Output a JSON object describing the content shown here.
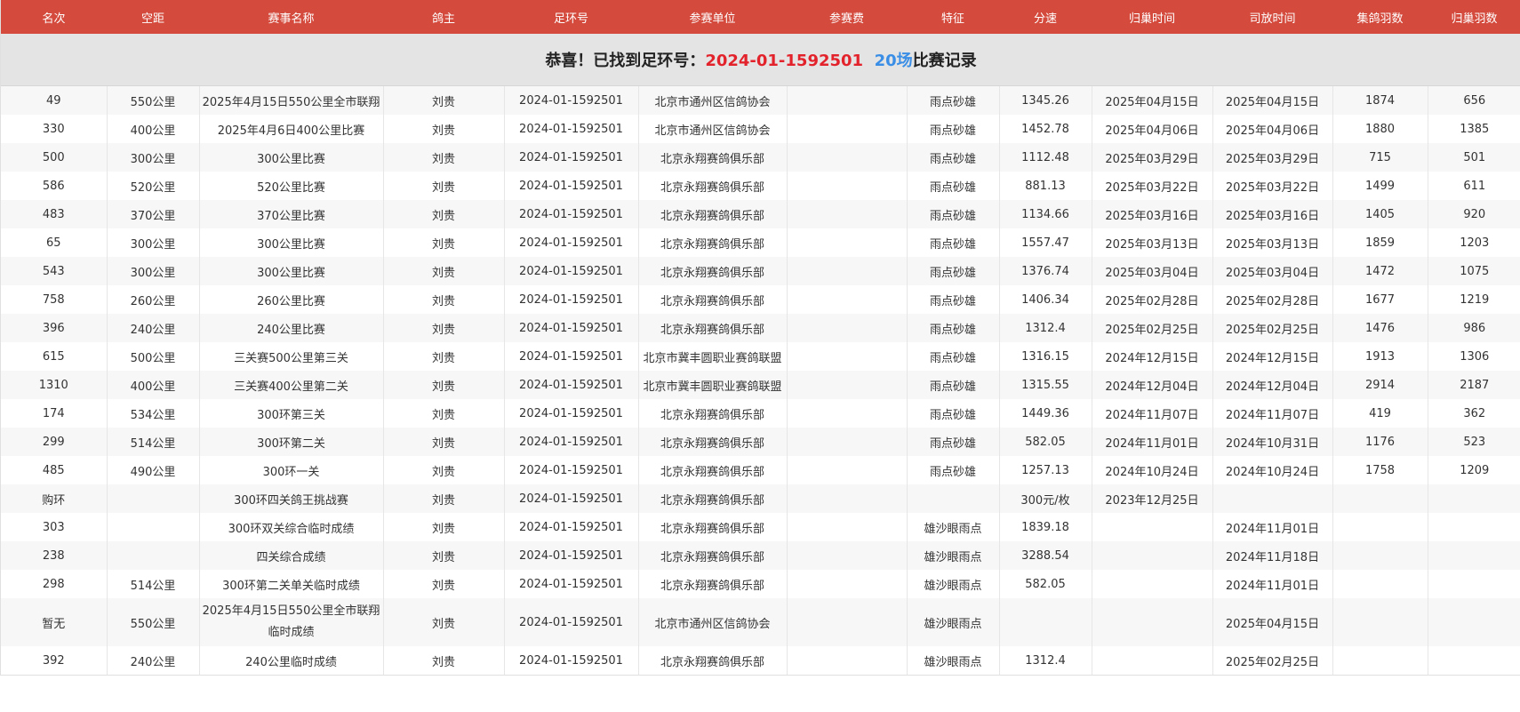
{
  "headers": [
    "名次",
    "空距",
    "赛事名称",
    "鸽主",
    "足环号",
    "参赛单位",
    "参赛费",
    "特征",
    "分速",
    "归巢时间",
    "司放时间",
    "集鸽羽数",
    "归巢羽数"
  ],
  "banner": {
    "prefix": "恭喜！已找到足环号：",
    "ring": "2024-01-1592501",
    "count": "20场",
    "suffix": "比赛记录"
  },
  "rows": [
    [
      "49",
      "550公里",
      "2025年4月15日550公里全市联翔",
      "刘贵",
      "2024-01-1592501",
      "北京市通州区信鸽协会",
      "",
      "雨点砂雄",
      "1345.26",
      "2025年04月15日",
      "2025年04月15日",
      "1874",
      "656"
    ],
    [
      "330",
      "400公里",
      "2025年4月6日400公里比赛",
      "刘贵",
      "2024-01-1592501",
      "北京市通州区信鸽协会",
      "",
      "雨点砂雄",
      "1452.78",
      "2025年04月06日",
      "2025年04月06日",
      "1880",
      "1385"
    ],
    [
      "500",
      "300公里",
      "300公里比赛",
      "刘贵",
      "2024-01-1592501",
      "北京永翔赛鸽俱乐部",
      "",
      "雨点砂雄",
      "1112.48",
      "2025年03月29日",
      "2025年03月29日",
      "715",
      "501"
    ],
    [
      "586",
      "520公里",
      "520公里比赛",
      "刘贵",
      "2024-01-1592501",
      "北京永翔赛鸽俱乐部",
      "",
      "雨点砂雄",
      "881.13",
      "2025年03月22日",
      "2025年03月22日",
      "1499",
      "611"
    ],
    [
      "483",
      "370公里",
      "370公里比赛",
      "刘贵",
      "2024-01-1592501",
      "北京永翔赛鸽俱乐部",
      "",
      "雨点砂雄",
      "1134.66",
      "2025年03月16日",
      "2025年03月16日",
      "1405",
      "920"
    ],
    [
      "65",
      "300公里",
      "300公里比赛",
      "刘贵",
      "2024-01-1592501",
      "北京永翔赛鸽俱乐部",
      "",
      "雨点砂雄",
      "1557.47",
      "2025年03月13日",
      "2025年03月13日",
      "1859",
      "1203"
    ],
    [
      "543",
      "300公里",
      "300公里比赛",
      "刘贵",
      "2024-01-1592501",
      "北京永翔赛鸽俱乐部",
      "",
      "雨点砂雄",
      "1376.74",
      "2025年03月04日",
      "2025年03月04日",
      "1472",
      "1075"
    ],
    [
      "758",
      "260公里",
      "260公里比赛",
      "刘贵",
      "2024-01-1592501",
      "北京永翔赛鸽俱乐部",
      "",
      "雨点砂雄",
      "1406.34",
      "2025年02月28日",
      "2025年02月28日",
      "1677",
      "1219"
    ],
    [
      "396",
      "240公里",
      "240公里比赛",
      "刘贵",
      "2024-01-1592501",
      "北京永翔赛鸽俱乐部",
      "",
      "雨点砂雄",
      "1312.4",
      "2025年02月25日",
      "2025年02月25日",
      "1476",
      "986"
    ],
    [
      "615",
      "500公里",
      "三关赛500公里第三关",
      "刘贵",
      "2024-01-1592501",
      "北京市冀丰圆职业赛鸽联盟",
      "",
      "雨点砂雄",
      "1316.15",
      "2024年12月15日",
      "2024年12月15日",
      "1913",
      "1306"
    ],
    [
      "1310",
      "400公里",
      "三关赛400公里第二关",
      "刘贵",
      "2024-01-1592501",
      "北京市冀丰圆职业赛鸽联盟",
      "",
      "雨点砂雄",
      "1315.55",
      "2024年12月04日",
      "2024年12月04日",
      "2914",
      "2187"
    ],
    [
      "174",
      "534公里",
      "300环第三关",
      "刘贵",
      "2024-01-1592501",
      "北京永翔赛鸽俱乐部",
      "",
      "雨点砂雄",
      "1449.36",
      "2024年11月07日",
      "2024年11月07日",
      "419",
      "362"
    ],
    [
      "299",
      "514公里",
      "300环第二关",
      "刘贵",
      "2024-01-1592501",
      "北京永翔赛鸽俱乐部",
      "",
      "雨点砂雄",
      "582.05",
      "2024年11月01日",
      "2024年10月31日",
      "1176",
      "523"
    ],
    [
      "485",
      "490公里",
      "300环一关",
      "刘贵",
      "2024-01-1592501",
      "北京永翔赛鸽俱乐部",
      "",
      "雨点砂雄",
      "1257.13",
      "2024年10月24日",
      "2024年10月24日",
      "1758",
      "1209"
    ],
    [
      "购环",
      "",
      "300环四关鸽王挑战赛",
      "刘贵",
      "2024-01-1592501",
      "北京永翔赛鸽俱乐部",
      "",
      "",
      "300元/枚",
      "2023年12月25日",
      "",
      "",
      ""
    ],
    [
      "303",
      "",
      "300环双关综合临时成绩",
      "刘贵",
      "2024-01-1592501",
      "北京永翔赛鸽俱乐部",
      "",
      "雄沙眼雨点",
      "1839.18",
      "",
      "2024年11月01日",
      "",
      ""
    ],
    [
      "238",
      "",
      "四关综合成绩",
      "刘贵",
      "2024-01-1592501",
      "北京永翔赛鸽俱乐部",
      "",
      "雄沙眼雨点",
      "3288.54",
      "",
      "2024年11月18日",
      "",
      ""
    ],
    [
      "298",
      "514公里",
      "300环第二关单关临时成绩",
      "刘贵",
      "2024-01-1592501",
      "北京永翔赛鸽俱乐部",
      "",
      "雄沙眼雨点",
      "582.05",
      "",
      "2024年11月01日",
      "",
      ""
    ],
    [
      "暂无",
      "550公里",
      "2025年4月15日550公里全市联翔临时成绩",
      "刘贵",
      "2024-01-1592501",
      "北京市通州区信鸽协会",
      "",
      "雄沙眼雨点",
      "",
      "",
      "2025年04月15日",
      "",
      ""
    ],
    [
      "392",
      "240公里",
      "240公里临时成绩",
      "刘贵",
      "2024-01-1592501",
      "北京永翔赛鸽俱乐部",
      "",
      "雄沙眼雨点",
      "1312.4",
      "",
      "2025年02月25日",
      "",
      ""
    ]
  ],
  "colors": {
    "header_bg": "#d44a3c",
    "ring_red": "#e3232c",
    "count_blue": "#3a8ee6",
    "banner_bg": "#e4e4e4"
  }
}
